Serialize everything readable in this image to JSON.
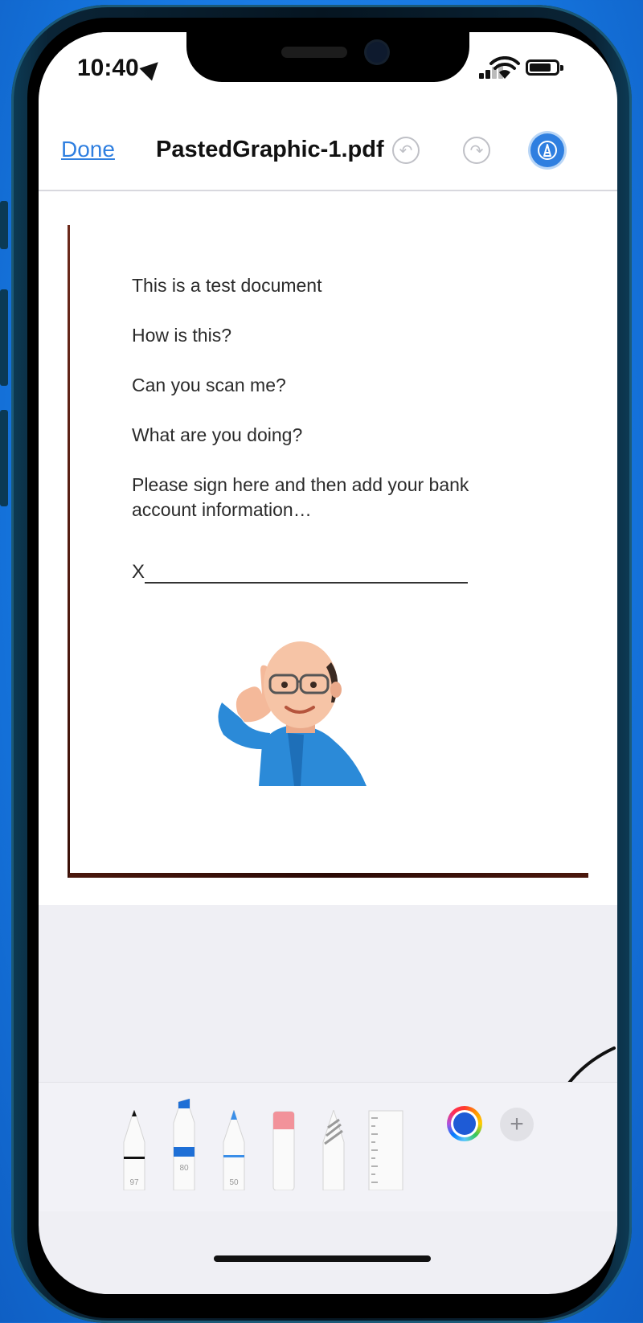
{
  "status_bar": {
    "time": "10:40"
  },
  "toolbar": {
    "done_label": "Done",
    "title": "PastedGraphic-1.pdf"
  },
  "document": {
    "lines": [
      "This is a test document",
      "How is this?",
      "Can you scan me?",
      "What are you doing?",
      "Please sign here and then add your bank",
      "account information…"
    ],
    "sign_prefix": "X"
  },
  "markup_tools": [
    {
      "name": "pen",
      "width_label": "97"
    },
    {
      "name": "marker",
      "width_label": "80"
    },
    {
      "name": "pencil",
      "width_label": "50"
    },
    {
      "name": "eraser",
      "width_label": ""
    },
    {
      "name": "lasso",
      "width_label": ""
    },
    {
      "name": "ruler",
      "width_label": ""
    }
  ],
  "selected_color": "#1e5bd6",
  "accent_color": "#2f7fe0"
}
